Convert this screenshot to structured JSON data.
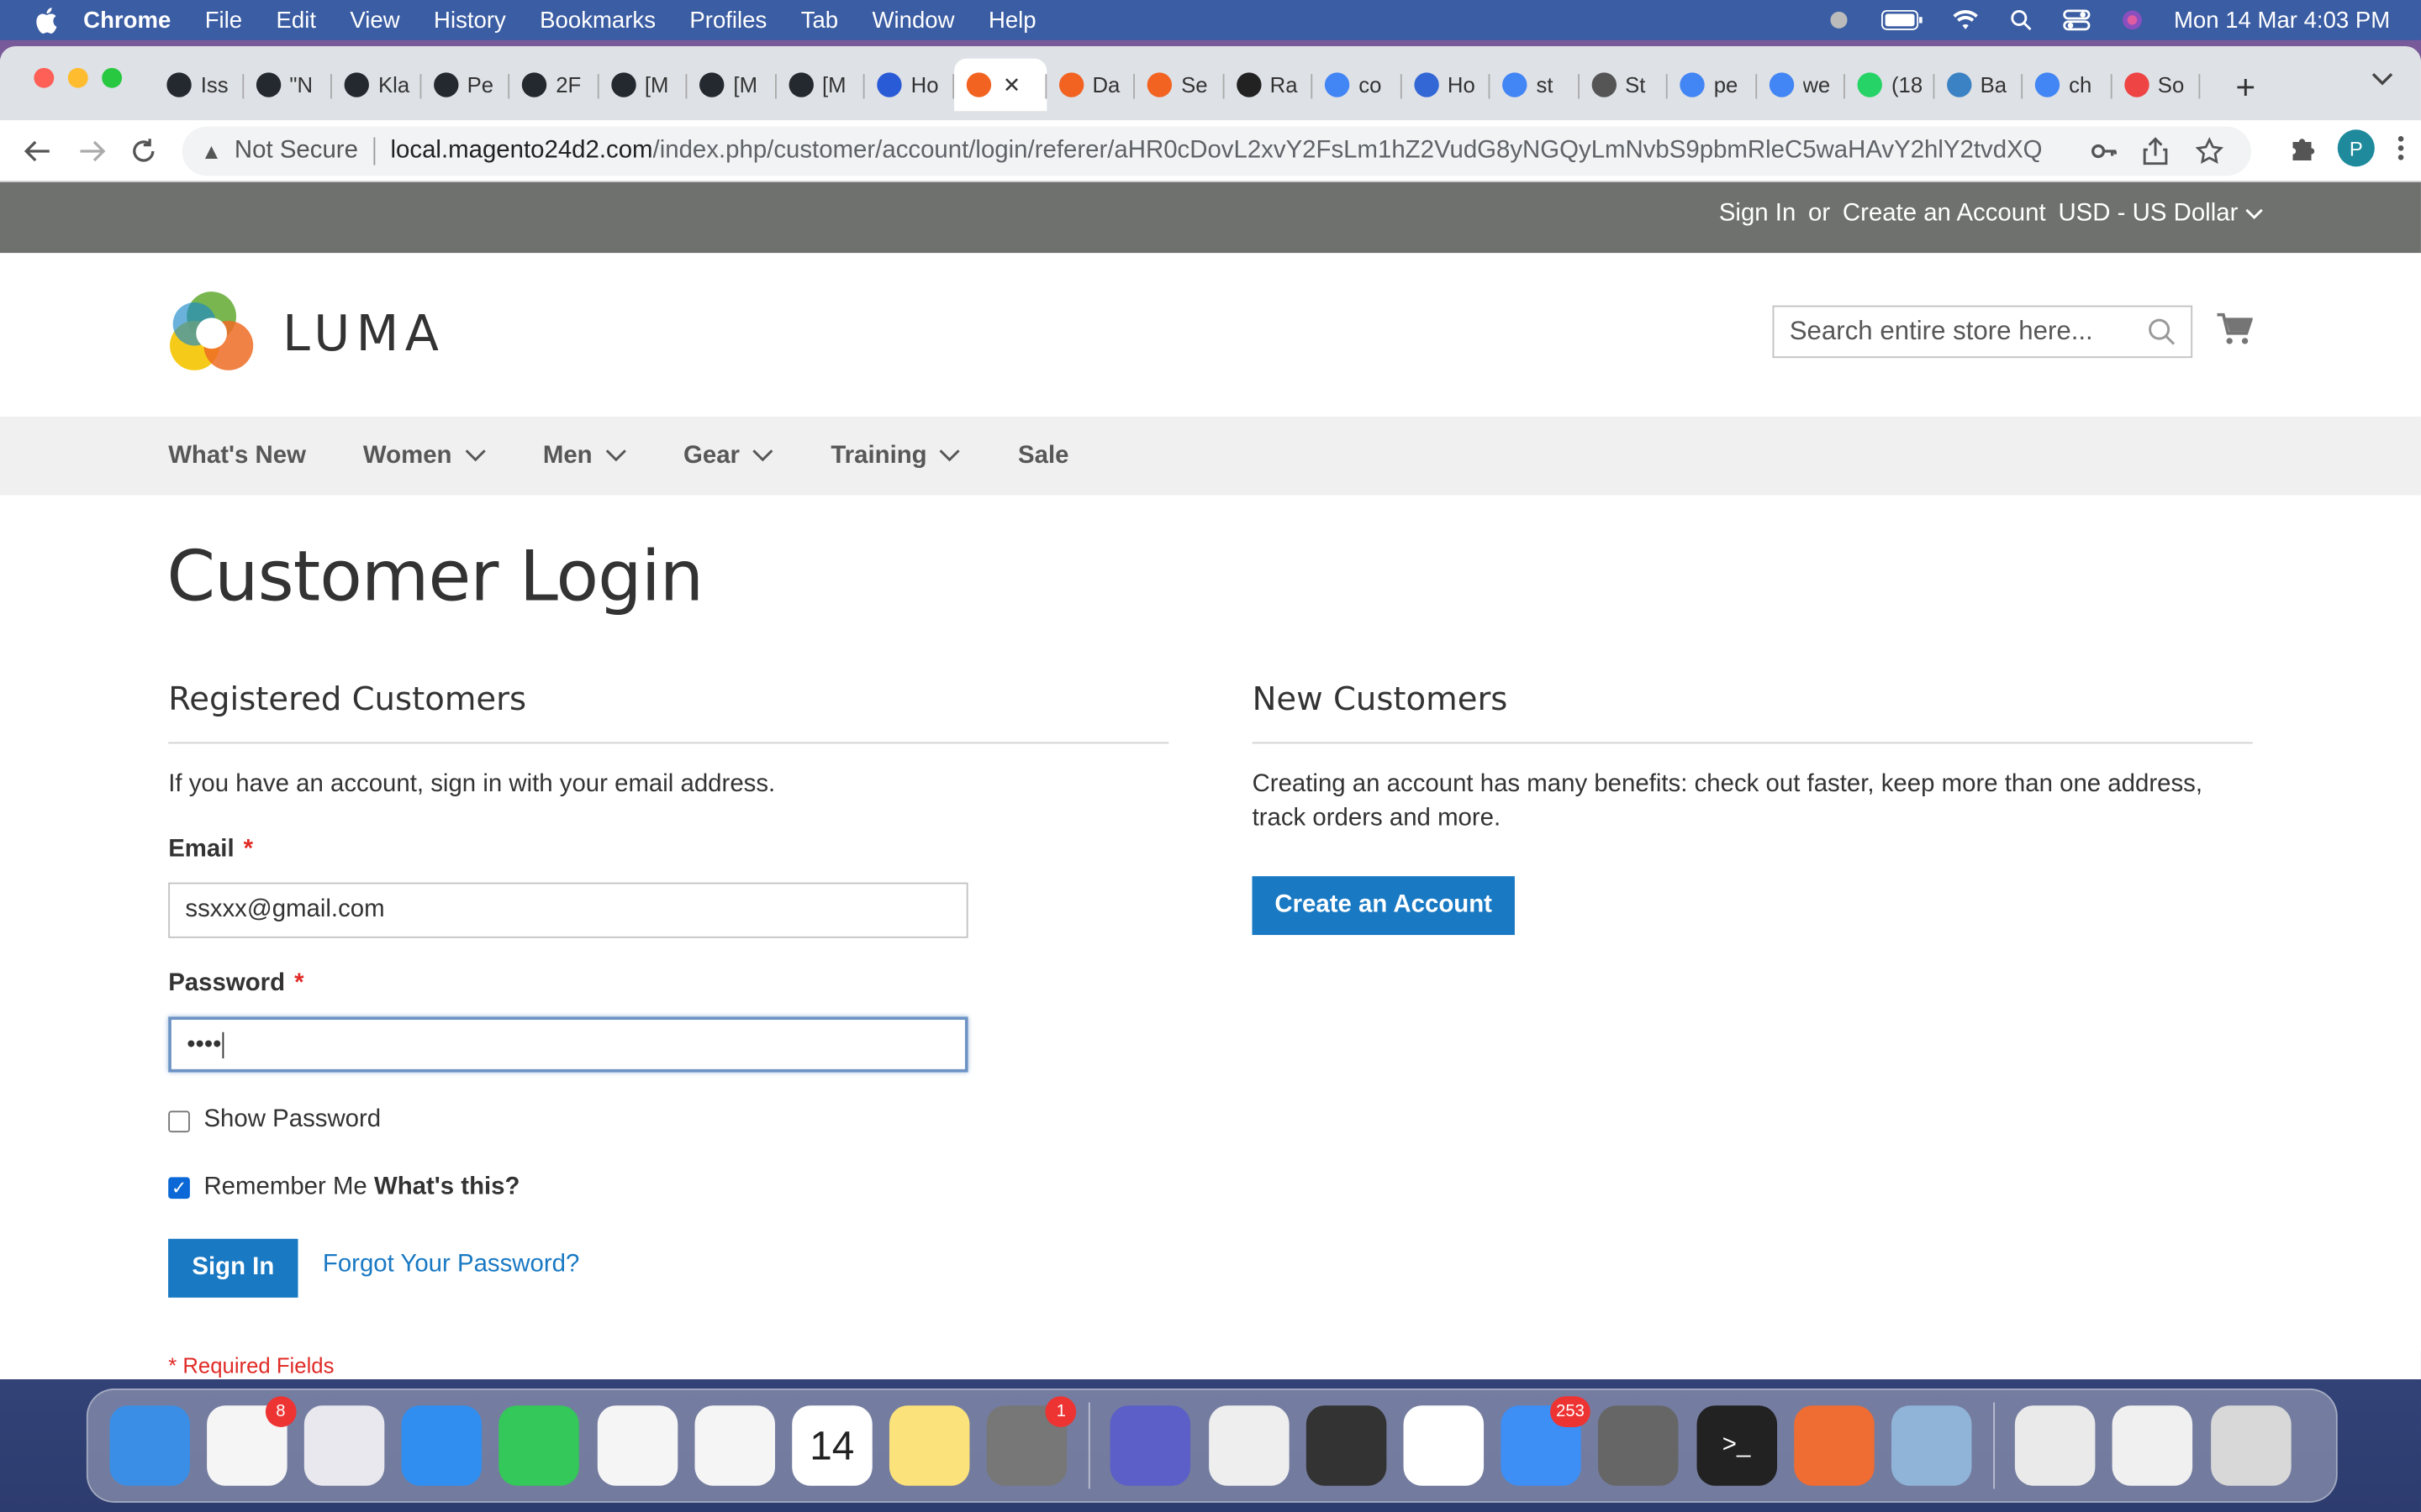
{
  "menubar": {
    "items": [
      "Chrome",
      "File",
      "Edit",
      "View",
      "History",
      "Bookmarks",
      "Profiles",
      "Tab",
      "Window",
      "Help"
    ],
    "datetime": "Mon 14 Mar  4:03 PM"
  },
  "browser": {
    "tabs": [
      {
        "label": "Iss",
        "icon": "github-icon",
        "color": "#24292f"
      },
      {
        "label": "\"N",
        "icon": "github-icon",
        "color": "#24292f"
      },
      {
        "label": "Kla",
        "icon": "github-icon",
        "color": "#24292f"
      },
      {
        "label": "Pe",
        "icon": "github-icon",
        "color": "#24292f"
      },
      {
        "label": "2F",
        "icon": "github-icon",
        "color": "#24292f"
      },
      {
        "label": "[M",
        "icon": "github-fail-icon",
        "color": "#24292f"
      },
      {
        "label": "[M",
        "icon": "github-fail-icon",
        "color": "#24292f"
      },
      {
        "label": "[M",
        "icon": "github-fail-icon",
        "color": "#24292f"
      },
      {
        "label": "Ho",
        "icon": "w-icon",
        "color": "#2a5bd7"
      },
      {
        "label": "",
        "icon": "magento-icon",
        "color": "#f26322",
        "active": true
      },
      {
        "label": "Da",
        "icon": "magento-icon",
        "color": "#f26322"
      },
      {
        "label": "Se",
        "icon": "magento-icon",
        "color": "#f26322"
      },
      {
        "label": "Ra",
        "icon": "dice-icon",
        "color": "#222"
      },
      {
        "label": "co",
        "icon": "google-icon",
        "color": "#4285f4"
      },
      {
        "label": "Ho",
        "icon": "at-icon",
        "color": "#3367d6"
      },
      {
        "label": "st",
        "icon": "google-icon",
        "color": "#4285f4"
      },
      {
        "label": "St",
        "icon": "globe-icon",
        "color": "#555"
      },
      {
        "label": "pe",
        "icon": "google-icon",
        "color": "#4285f4"
      },
      {
        "label": "we",
        "icon": "google-icon",
        "color": "#4285f4"
      },
      {
        "label": "(18",
        "icon": "whatsapp-icon",
        "color": "#25d366"
      },
      {
        "label": "Ba",
        "icon": "doc-icon",
        "color": "#3b82c4"
      },
      {
        "label": "ch",
        "icon": "google-icon",
        "color": "#4285f4"
      },
      {
        "label": "So",
        "icon": "rainbow-icon",
        "color": "#e44"
      }
    ],
    "security": "Not Secure",
    "url_host": "local.magento24d2.com",
    "url_path": "/index.php/customer/account/login/referer/aHR0cDovL2xvY2FsLm1hZ2VudG8yNGQyLmNvbS9pbmRleC5waHAvY2hlY2tvdXQ..."
  },
  "store": {
    "header_links": {
      "sign_in": "Sign In",
      "or": "or",
      "create_account": "Create an Account"
    },
    "currency": "USD - US Dollar",
    "logo_text": "LUMA",
    "search_placeholder": "Search entire store here...",
    "nav": [
      {
        "label": "What's New",
        "dropdown": false
      },
      {
        "label": "Women",
        "dropdown": true
      },
      {
        "label": "Men",
        "dropdown": true
      },
      {
        "label": "Gear",
        "dropdown": true
      },
      {
        "label": "Training",
        "dropdown": true
      },
      {
        "label": "Sale",
        "dropdown": false
      }
    ]
  },
  "login": {
    "page_title": "Customer Login",
    "registered": {
      "title": "Registered Customers",
      "intro": "If you have an account, sign in with your email address.",
      "email_label": "Email",
      "email_value": "ssxxx@gmail.com",
      "password_label": "Password",
      "password_value": "••••",
      "show_password": "Show Password",
      "remember_me": "Remember Me",
      "whats_this": "What's this?",
      "sign_in_button": "Sign In",
      "forgot_link": "Forgot Your Password?",
      "required_note": "* Required Fields",
      "required_mark": "*"
    },
    "new_customers": {
      "title": "New Customers",
      "text": "Creating an account has many benefits: check out faster, keep more than one address, track orders and more.",
      "button": "Create an Account"
    }
  },
  "dock": {
    "apps": [
      {
        "name": "finder-icon",
        "color": "#3a8ee6"
      },
      {
        "name": "reminders-icon",
        "color": "#f5f5f5",
        "badge": "8"
      },
      {
        "name": "launchpad-icon",
        "color": "#e8e8ee"
      },
      {
        "name": "safari-icon",
        "color": "#2f8ef0"
      },
      {
        "name": "messages-icon",
        "color": "#34c759"
      },
      {
        "name": "photos-icon",
        "color": "#f5f5f5"
      },
      {
        "name": "chrome-icon",
        "color": "#f5f5f5"
      },
      {
        "name": "calendar-icon",
        "color": "#ffffff",
        "text": "14"
      },
      {
        "name": "notes-icon",
        "color": "#fbe27a"
      },
      {
        "name": "system-preferences-icon",
        "color": "#777",
        "badge": "1"
      },
      {
        "name": "teams-icon",
        "color": "#5b5fc7"
      },
      {
        "name": "textedit-icon",
        "color": "#eee"
      },
      {
        "name": "sublime-icon",
        "color": "#333"
      },
      {
        "name": "slack-icon",
        "color": "#fff"
      },
      {
        "name": "mail-icon",
        "color": "#3d8ef5",
        "badge": "253"
      },
      {
        "name": "tableplus-icon",
        "color": "#666"
      },
      {
        "name": "terminal-icon",
        "color": "#222",
        "text": ">_"
      },
      {
        "name": "postman-icon",
        "color": "#ef6c33"
      },
      {
        "name": "preview-icon",
        "color": "#8fb4d8"
      },
      {
        "name": "pdf-doc-icon",
        "color": "#eaeaea"
      },
      {
        "name": "presentation-doc-icon",
        "color": "#f0f0f0"
      },
      {
        "name": "trash-icon",
        "color": "#d8d8d8"
      }
    ]
  },
  "colors": {
    "accent": "#1979c3",
    "required": "#e02b27",
    "header_bar": "#6e716e"
  }
}
